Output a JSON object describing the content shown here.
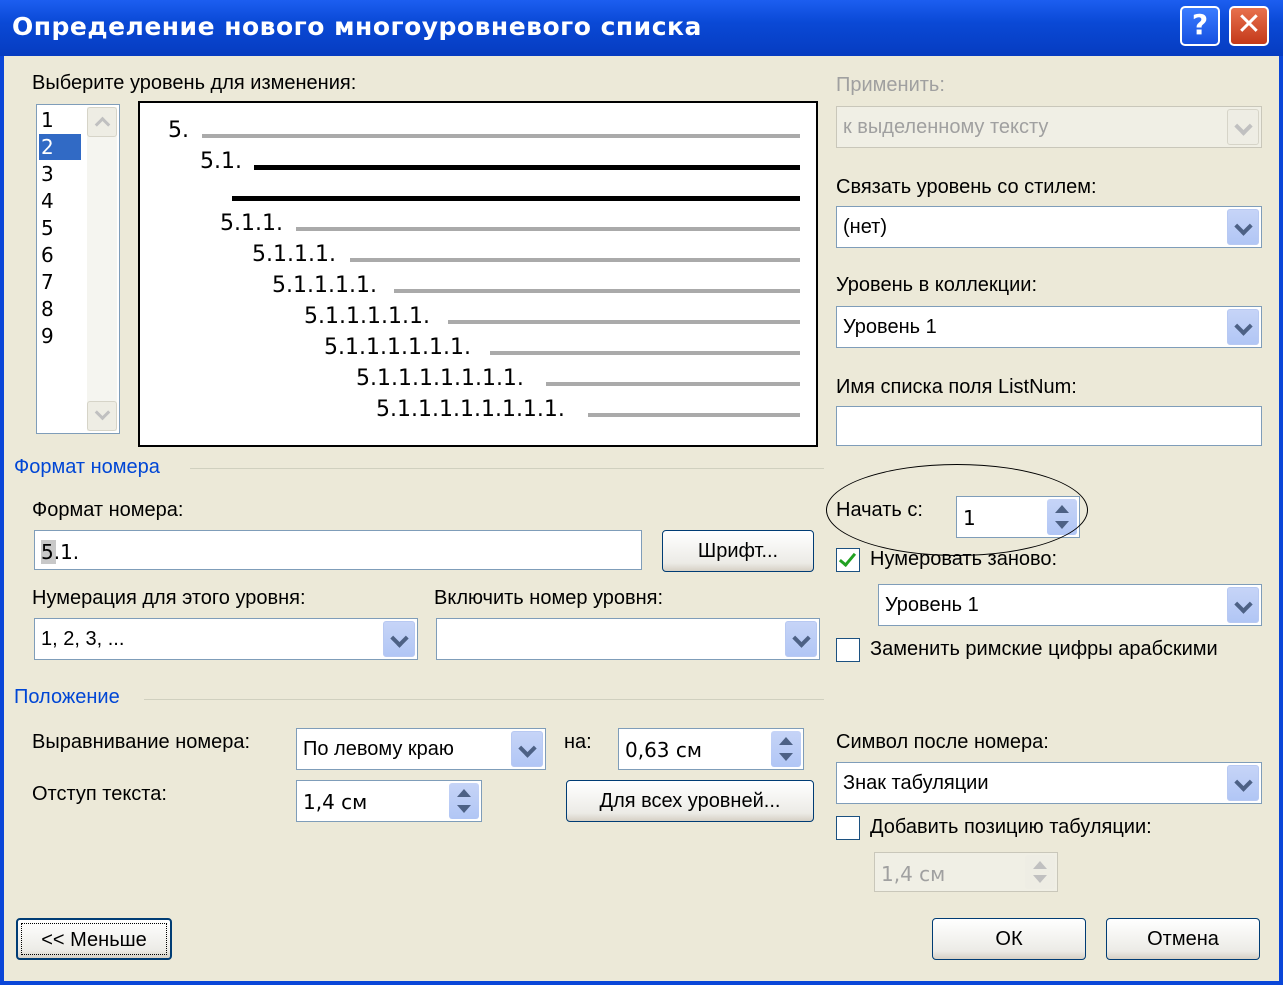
{
  "window": {
    "title": "Определение нового многоуровневого списка",
    "help_label": "?",
    "close_label": "✕"
  },
  "level_select": {
    "label": "Выберите уровень для изменения:",
    "levels": [
      "1",
      "2",
      "3",
      "4",
      "5",
      "6",
      "7",
      "8",
      "9"
    ],
    "selected": "2"
  },
  "preview": {
    "items": [
      {
        "num": "5."
      },
      {
        "num": "5.1."
      },
      {
        "num": ""
      },
      {
        "num": "5.1.1."
      },
      {
        "num": "5.1.1.1."
      },
      {
        "num": "5.1.1.1.1."
      },
      {
        "num": "5.1.1.1.1.1."
      },
      {
        "num": "5.1.1.1.1.1.1."
      },
      {
        "num": "5.1.1.1.1.1.1.1."
      },
      {
        "num": "5.1.1.1.1.1.1.1.1."
      }
    ]
  },
  "apply": {
    "label": "Применить:",
    "value": "к выделенному тексту"
  },
  "link_style": {
    "label": "Связать уровень со стилем:",
    "value": "(нет)"
  },
  "gallery_level": {
    "label": "Уровень в коллекции:",
    "value": "Уровень 1"
  },
  "listnum": {
    "label": "Имя списка поля ListNum:",
    "value": ""
  },
  "number_format_group": {
    "title": "Формат номера"
  },
  "number_format": {
    "label": "Формат номера:",
    "value": "5.1."
  },
  "font_button": {
    "label": "Шрифт..."
  },
  "start_at": {
    "label": "Начать с:",
    "value": "1"
  },
  "restart": {
    "label": "Нумеровать заново:",
    "checked": true,
    "value": "Уровень 1"
  },
  "numbering_style": {
    "label": "Нумерация для этого уровня:",
    "value": "1, 2, 3, ..."
  },
  "include_level": {
    "label": "Включить номер уровня:",
    "value": ""
  },
  "legal": {
    "label": "Заменить римские цифры арабскими",
    "checked": false
  },
  "position_group": {
    "title": "Положение"
  },
  "alignment": {
    "label": "Выравнивание номера:",
    "value": "По левому краю"
  },
  "aligned_at": {
    "label": "на:",
    "value": "0,63 см"
  },
  "text_indent": {
    "label": "Отступ текста:",
    "value": "1,4 см"
  },
  "all_levels_button": {
    "label": "Для всех уровней..."
  },
  "follow_number": {
    "label": "Символ после номера:",
    "value": "Знак табуляции"
  },
  "tab_stop": {
    "label": "Добавить позицию табуляции:",
    "checked": false,
    "value": "1,4 см"
  },
  "less_button": {
    "label": "<< Меньше"
  },
  "ok_button": {
    "label": "ОК"
  },
  "cancel_button": {
    "label": "Отмена"
  }
}
